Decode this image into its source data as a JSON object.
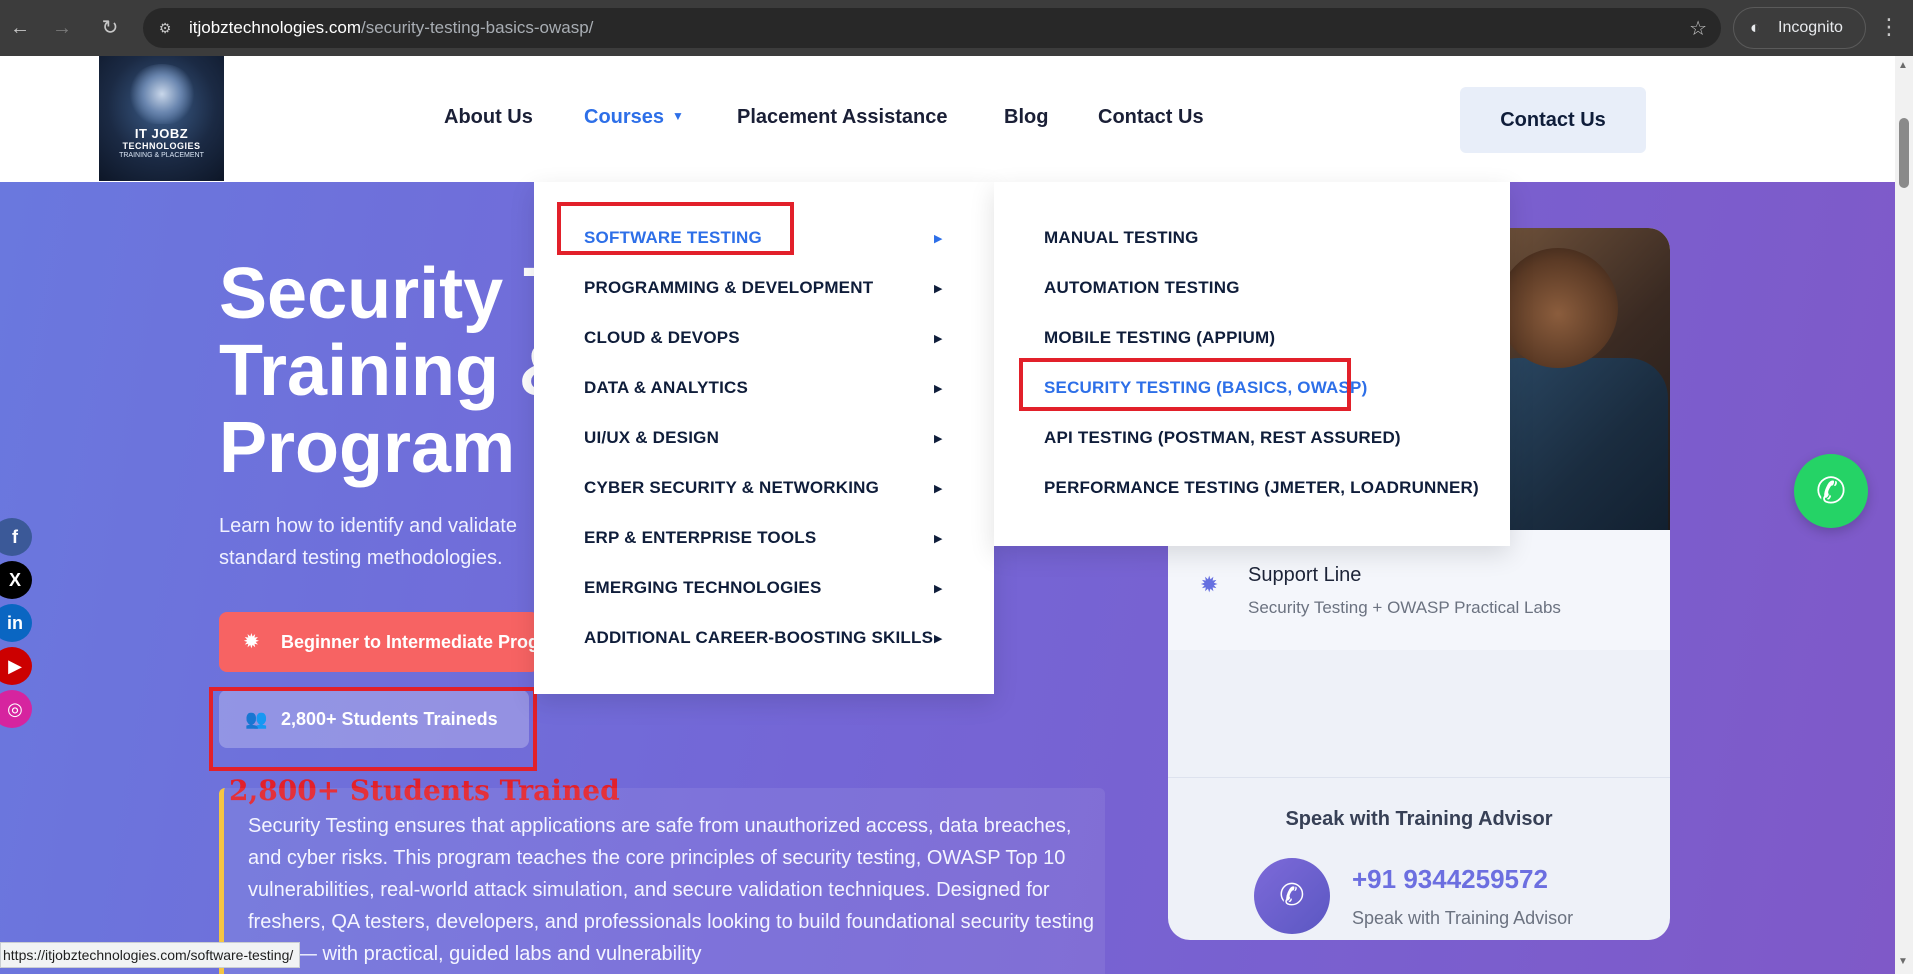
{
  "browser": {
    "url_host": "itjobztechnologies.com",
    "url_path": "/security-testing-basics-owasp/",
    "incognito_label": "Incognito",
    "status_url": "https://itjobztechnologies.com/software-testing/"
  },
  "header": {
    "logo_text": "IT JOBZ",
    "logo_subtext": "TECHNOLOGIES",
    "logo_tagline": "TRAINING & PLACEMENT",
    "nav": [
      {
        "label": "About Us"
      },
      {
        "label": "Courses"
      },
      {
        "label": "Placement Assistance"
      },
      {
        "label": "Blog"
      },
      {
        "label": "Contact Us"
      }
    ],
    "cta_label": "Contact Us"
  },
  "courses_menu": {
    "categories": [
      {
        "label": "SOFTWARE TESTING"
      },
      {
        "label": "PROGRAMMING & DEVELOPMENT"
      },
      {
        "label": "CLOUD & DEVOPS"
      },
      {
        "label": "DATA & ANALYTICS"
      },
      {
        "label": "UI/UX & DESIGN"
      },
      {
        "label": "CYBER SECURITY & NETWORKING"
      },
      {
        "label": "ERP & ENTERPRISE TOOLS"
      },
      {
        "label": "EMERGING TECHNOLOGIES"
      },
      {
        "label": "ADDITIONAL CAREER-BOOSTING SKILLS"
      }
    ],
    "submenu": [
      {
        "label": "MANUAL TESTING"
      },
      {
        "label": "AUTOMATION TESTING"
      },
      {
        "label": "MOBILE TESTING (APPIUM)"
      },
      {
        "label": "SECURITY TESTING (BASICS, OWASP)"
      },
      {
        "label": "API TESTING (POSTMAN, REST ASSURED)"
      },
      {
        "label": "PERFORMANCE TESTING (JMETER, LOADRUNNER)"
      }
    ]
  },
  "hero": {
    "title_line1": "Security T",
    "title_line2": "Training &",
    "title_line3": "Program",
    "description": "Learn how to identify and validate standard testing methodologies.",
    "level_badge": "Beginner to Intermediate Prog",
    "students_badge": "2,800+ Students Traineds",
    "annotation": "2,800+ Students Trained",
    "about": "Security Testing ensures that applications are safe from unauthorized access, data breaches, and cyber risks. This program teaches the core principles of security testing, OWASP Top 10 vulnerabilities, real-world attack simulation, and secure validation techniques. Designed for freshers, QA testers, developers, and professionals looking to build foundational security testing skills — with practical, guided labs and vulnerability"
  },
  "side_card": {
    "support_title": "Support Line",
    "support_sub": "Security Testing + OWASP Practical Labs",
    "advisor_title": "Speak with Training Advisor",
    "phone": "+91 9344259572",
    "phone_sub": "Speak with Training Advisor"
  },
  "social": [
    {
      "icon": "facebook-icon",
      "glyph": "f",
      "color": "#3b5998"
    },
    {
      "icon": "x-icon",
      "glyph": "X",
      "color": "#000000"
    },
    {
      "icon": "linkedin-icon",
      "glyph": "in",
      "color": "#0a66c2"
    },
    {
      "icon": "youtube-icon",
      "glyph": "▶",
      "color": "#cc0000"
    },
    {
      "icon": "instagram-icon",
      "glyph": "◎",
      "color": "#d6249f"
    }
  ],
  "colors": {
    "accent": "#2d6fe8",
    "annotation_red": "#e2202a",
    "whatsapp": "#25d366"
  }
}
